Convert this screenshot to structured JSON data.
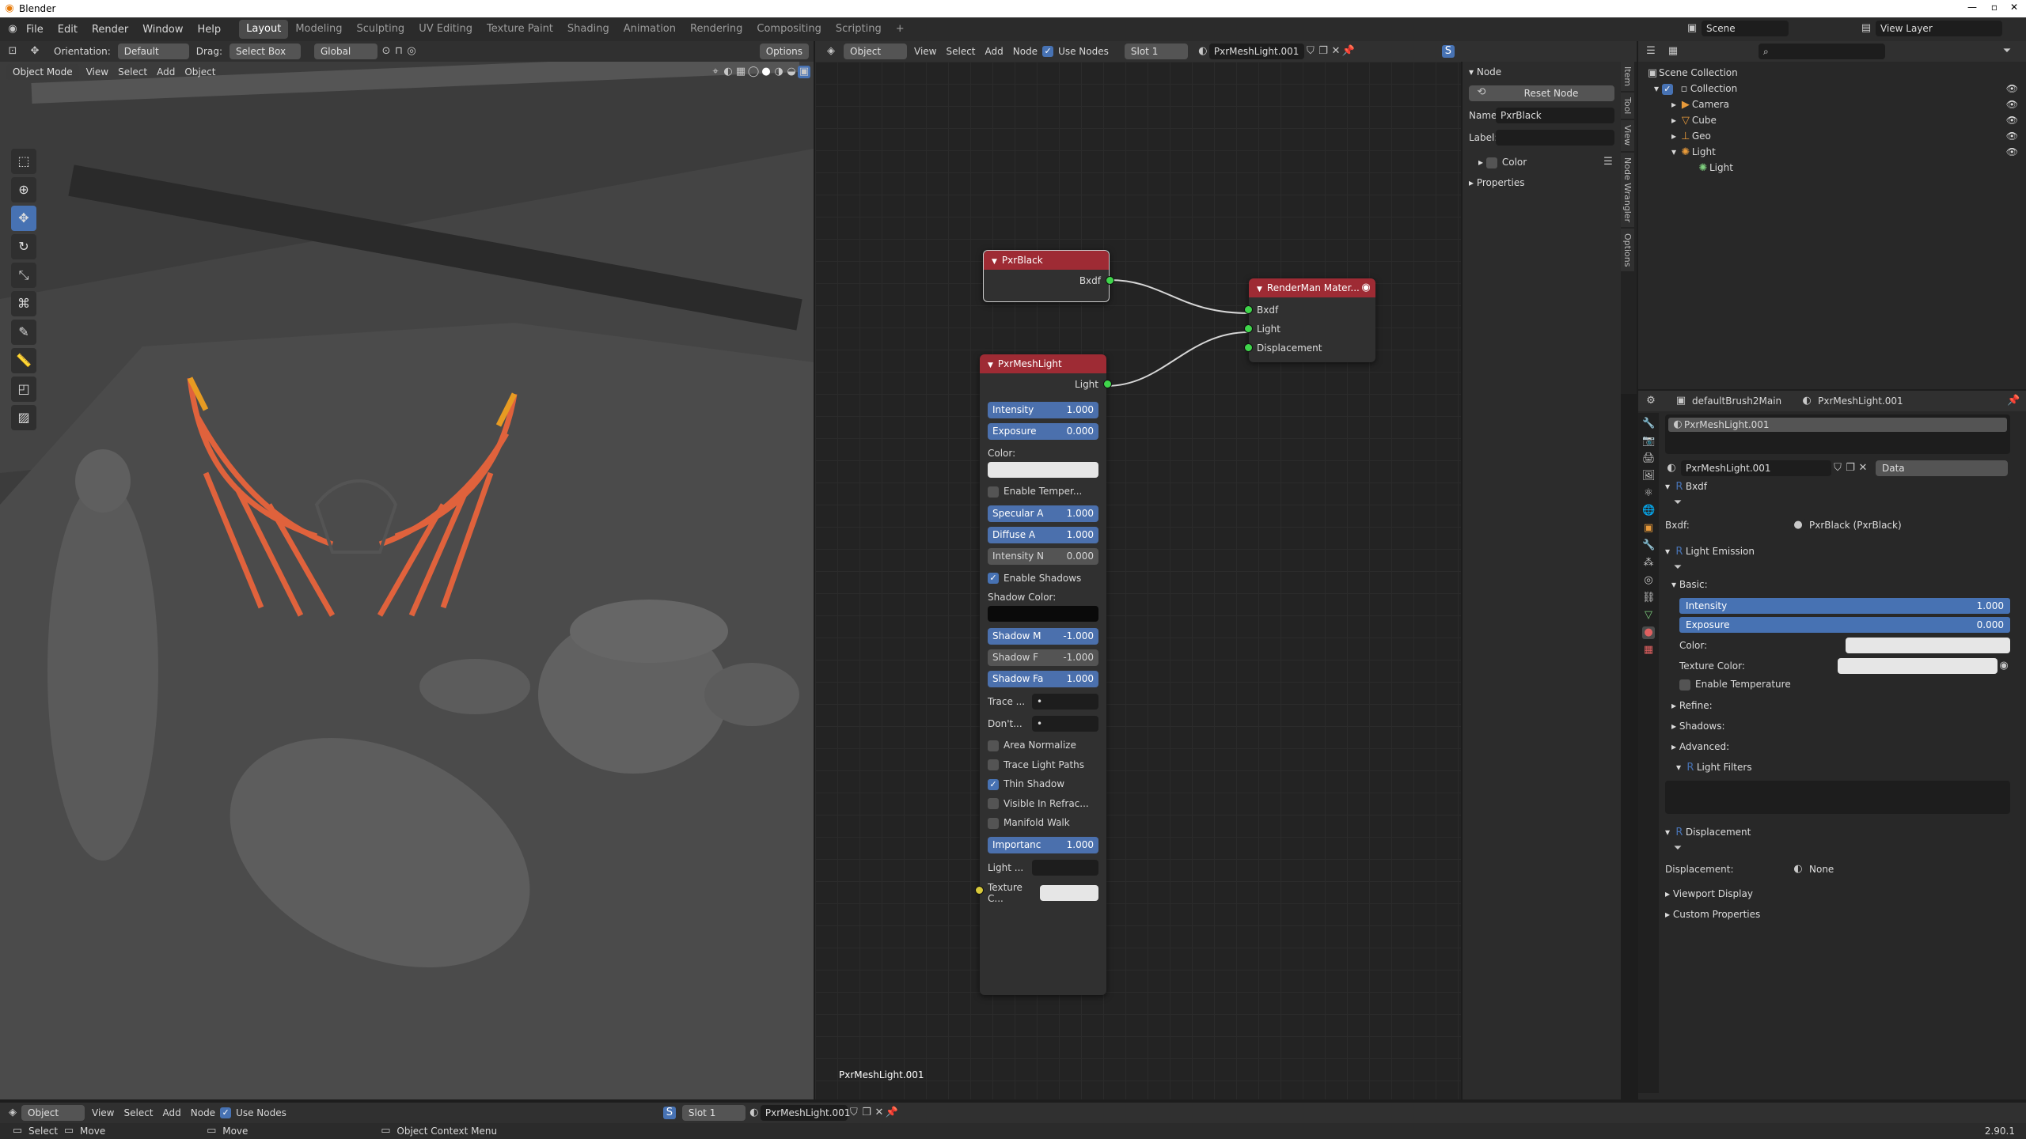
{
  "window": {
    "title": "Blender"
  },
  "menubar": {
    "items": [
      "File",
      "Edit",
      "Render",
      "Window",
      "Help"
    ],
    "tabs": [
      "Layout",
      "Modeling",
      "Sculpting",
      "UV Editing",
      "Texture Paint",
      "Shading",
      "Animation",
      "Rendering",
      "Compositing",
      "Scripting"
    ],
    "active_tab": "Layout",
    "scene_label": "Scene",
    "view_layer_label": "View Layer"
  },
  "viewport_header": {
    "orientation_label": "Orientation:",
    "orientation_value": "Default",
    "drag_label": "Drag:",
    "drag_value": "Select Box",
    "transform_value": "Global",
    "options_label": "Options",
    "mode": "Object Mode",
    "menus": [
      "View",
      "Select",
      "Add",
      "Object"
    ]
  },
  "node_header": {
    "object_label": "Object",
    "menus": [
      "View",
      "Select",
      "Add",
      "Node"
    ],
    "use_nodes_label": "Use Nodes",
    "slot_label": "Slot 1",
    "material_name": "PxrMeshLight.001"
  },
  "nodes": {
    "pxrblack": {
      "title": "PxrBlack",
      "output": "Bxdf"
    },
    "renderman": {
      "title": "RenderMan Mater...",
      "inputs": [
        "Bxdf",
        "Light",
        "Displacement"
      ]
    },
    "pxrmeshlight": {
      "title": "PxrMeshLight",
      "output": "Light",
      "intensity_label": "Intensity",
      "intensity_value": "1.000",
      "exposure_label": "Exposure",
      "exposure_value": "0.000",
      "color_label": "Color:",
      "enable_temp_label": "Enable Temper...",
      "specular_label": "Specular A",
      "specular_value": "1.000",
      "diffuse_label": "Diffuse A",
      "diffuse_value": "1.000",
      "intensityn_label": "Intensity N",
      "intensityn_value": "0.000",
      "enable_shadows_label": "Enable Shadows",
      "shadow_color_label": "Shadow Color:",
      "shadowm_label": "Shadow M",
      "shadowm_value": "-1.000",
      "shadowf_label": "Shadow F",
      "shadowf_value": "-1.000",
      "shadowfa_label": "Shadow Fa",
      "shadowfa_value": "1.000",
      "trace_label": "Trace ...",
      "dont_label": "Don't...",
      "area_normalize_label": "Area Normalize",
      "trace_light_paths_label": "Trace Light Paths",
      "thin_shadow_label": "Thin Shadow",
      "visible_refrac_label": "Visible In Refrac...",
      "manifold_walk_label": "Manifold Walk",
      "importance_label": "Importanc",
      "importance_value": "1.000",
      "light_label": "Light ...",
      "texture_label": "Texture C..."
    },
    "editor_footer_label": "PxrMeshLight.001"
  },
  "node_sidebar": {
    "section": "Node",
    "reset_button": "Reset Node",
    "name_label": "Name:",
    "name_value": "PxrBlack",
    "label_label": "Label:",
    "color_label": "Color",
    "properties_label": "Properties",
    "tabs": [
      "Item",
      "Tool",
      "View",
      "Node Wrangler",
      "Options"
    ]
  },
  "outliner": {
    "root": "Scene Collection",
    "collection": "Collection",
    "items": [
      "Camera",
      "Cube",
      "Geo",
      "Light"
    ],
    "sub_item": "Light"
  },
  "properties": {
    "breadcrumb_object": "defaultBrush2Main",
    "breadcrumb_material": "PxrMeshLight.001",
    "slot_name": "PxrMeshLight.001",
    "material_field": "PxrMeshLight.001",
    "data_label": "Data",
    "bxdf_section": "Bxdf",
    "bxdf_label": "Bxdf:",
    "bxdf_value": "PxrBlack (PxrBlack)",
    "light_emission_section": "Light Emission",
    "basic_label": "Basic:",
    "intensity_label": "Intensity",
    "intensity_value": "1.000",
    "exposure_label": "Exposure",
    "exposure_value": "0.000",
    "color_label": "Color:",
    "texture_color_label": "Texture Color:",
    "enable_temp_label": "Enable Temperature",
    "refine_label": "Refine:",
    "shadows_label": "Shadows:",
    "advanced_label": "Advanced:",
    "light_filters_label": "Light Filters",
    "displacement_section": "Displacement",
    "displacement_label": "Displacement:",
    "displacement_value": "None",
    "viewport_display": "Viewport Display",
    "custom_props": "Custom Properties"
  },
  "bottom_header": {
    "object_label": "Object",
    "menus": [
      "View",
      "Select",
      "Add",
      "Node"
    ],
    "use_nodes_label": "Use Nodes",
    "slot_label": "Slot 1",
    "material_name": "PxrMeshLight.001"
  },
  "statusbar": {
    "select": "Select",
    "move": "Move",
    "move2": "Move",
    "context": "Object Context Menu",
    "version": "2.90.1"
  },
  "colors": {
    "accent": "#4772b3",
    "node_header": "#9e2b34",
    "socket_green": "#3fd54b",
    "neon": "#e8643c"
  }
}
